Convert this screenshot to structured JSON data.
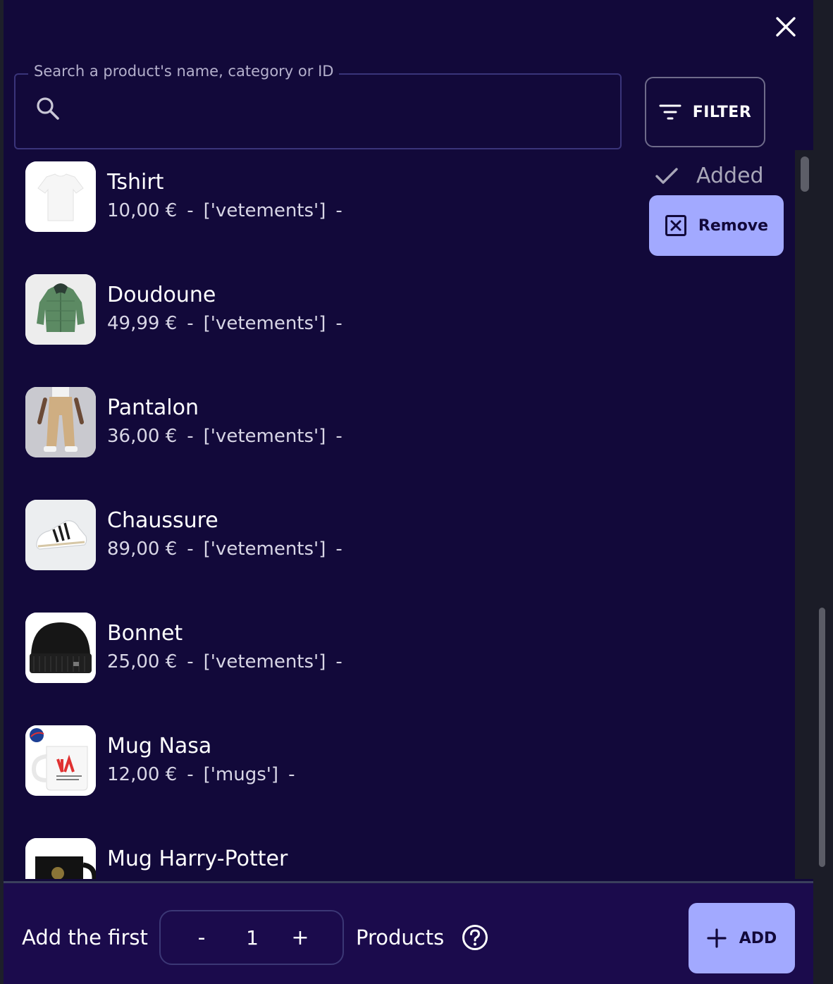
{
  "search": {
    "label": "Search a product's name, category or ID",
    "value": ""
  },
  "filter": {
    "label": "FILTER",
    "icon": "filter-icon"
  },
  "close": {
    "icon": "close-icon"
  },
  "selected_product": {
    "status_label": "Added",
    "status_icon": "check-icon",
    "remove_label": "Remove",
    "remove_icon": "close-box-icon"
  },
  "products": [
    {
      "name": "Tshirt",
      "price": "10,00 €",
      "categories": "['vetements']",
      "dash": "-",
      "sep": "-",
      "image": "tshirt"
    },
    {
      "name": "Doudoune",
      "price": "49,99 €",
      "categories": "['vetements']",
      "dash": "-",
      "sep": "-",
      "image": "jacket"
    },
    {
      "name": "Pantalon",
      "price": "36,00 €",
      "categories": "['vetements']",
      "dash": "-",
      "sep": "-",
      "image": "pants"
    },
    {
      "name": "Chaussure",
      "price": "89,00 €",
      "categories": "['vetements']",
      "dash": "-",
      "sep": "-",
      "image": "shoe"
    },
    {
      "name": "Bonnet",
      "price": "25,00 €",
      "categories": "['vetements']",
      "dash": "-",
      "sep": "-",
      "image": "beanie"
    },
    {
      "name": "Mug Nasa",
      "price": "12,00 €",
      "categories": "['mugs']",
      "dash": "-",
      "sep": "-",
      "image": "mug-nasa"
    },
    {
      "name": "Mug Harry-Potter",
      "price": "",
      "categories": "",
      "dash": "",
      "sep": "",
      "image": "mug-hp"
    }
  ],
  "footer": {
    "prefix": "Add the first",
    "quantity": "1",
    "minus": "-",
    "plus": "+",
    "suffix": "Products",
    "help_icon": "help-circle-icon",
    "add_label": "ADD",
    "add_icon": "plus-icon"
  },
  "colors": {
    "background": "#12093a",
    "accent": "#a2a9ff",
    "footer": "#1b0b4c"
  }
}
